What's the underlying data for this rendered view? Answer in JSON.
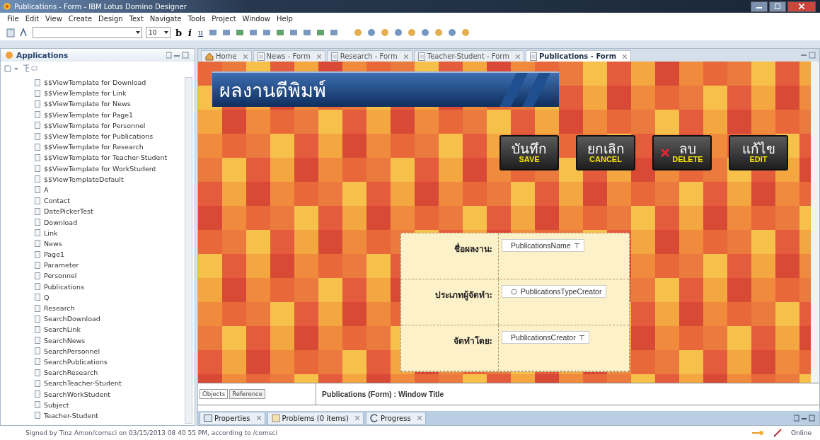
{
  "window": {
    "title": "Publications - Form - IBM Lotus Domino Designer"
  },
  "menu": [
    "File",
    "Edit",
    "View",
    "Create",
    "Design",
    "Text",
    "Navigate",
    "Tools",
    "Project",
    "Window",
    "Help"
  ],
  "toolbar": {
    "font_size": "10",
    "format_buttons": [
      "b",
      "i",
      "u"
    ]
  },
  "applications_panel": {
    "title": "Applications",
    "items": [
      "$$ViewTemplate for Download",
      "$$ViewTemplate for Link",
      "$$ViewTemplate for News",
      "$$ViewTemplate for Page1",
      "$$ViewTemplate for Personnel",
      "$$ViewTemplate for Publications",
      "$$ViewTemplate for Research",
      "$$ViewTemplate for Teacher-Student",
      "$$ViewTemplate for WorkStudent",
      "$$ViewTemplateDefault",
      "A",
      "Contact",
      "DatePickerTest",
      "Download",
      "Link",
      "News",
      "Page1",
      "Parameter",
      "Personnel",
      "Publications",
      "Q",
      "Research",
      "SearchDownload",
      "SearchLink",
      "SearchNews",
      "SearchPersonnel",
      "SearchPublications",
      "SearchResearch",
      "SearchTeacher-Student",
      "SearchWorkStudent",
      "Subject",
      "Teacher-Student"
    ]
  },
  "editor_tabs": [
    {
      "label": "Home",
      "kind": "home",
      "selected": false
    },
    {
      "label": "News - Form",
      "kind": "form",
      "selected": false
    },
    {
      "label": "Research - Form",
      "kind": "form",
      "selected": false
    },
    {
      "label": "Teacher-Student - Form",
      "kind": "form",
      "selected": false
    },
    {
      "label": "Publications - Form",
      "kind": "form",
      "selected": true
    }
  ],
  "form": {
    "banner_title": "ผลงานตีพิมพ์",
    "buttons": [
      {
        "thai": "บันทึก",
        "english": "SAVE",
        "kind": "plain"
      },
      {
        "thai": "ยกเลิก",
        "english": "CANCEL",
        "kind": "plain"
      },
      {
        "thai": "ลบ",
        "english": "DELETE",
        "kind": "delete"
      },
      {
        "thai": "แก้ไข",
        "english": "EDIT",
        "kind": "plain"
      }
    ],
    "fields": [
      {
        "label": "ชื่อผลงาน:",
        "field": "PublicationsName",
        "kind": "text"
      },
      {
        "label": "ประเภทผู้จัดทำ:",
        "field": "PublicationsTypeCreator",
        "kind": "radio"
      },
      {
        "label": "จัดทำโดย:",
        "field": "PublicationsCreator",
        "kind": "text"
      }
    ]
  },
  "properties_pane": {
    "tabs": [
      {
        "label": "Objects",
        "selected": true
      },
      {
        "label": "Reference",
        "selected": false
      }
    ],
    "title": "Publications (Form) : Window Title"
  },
  "view_tabs": [
    {
      "label": "Properties",
      "kind": "properties"
    },
    {
      "label": "Problems (0 items)",
      "kind": "problems"
    },
    {
      "label": "Progress",
      "kind": "progress"
    }
  ],
  "status_bar": {
    "message": "Signed by Tinz Amon/comsci on 03/15/2013 08 40 55 PM, according to /comsci",
    "connection": "Online"
  }
}
